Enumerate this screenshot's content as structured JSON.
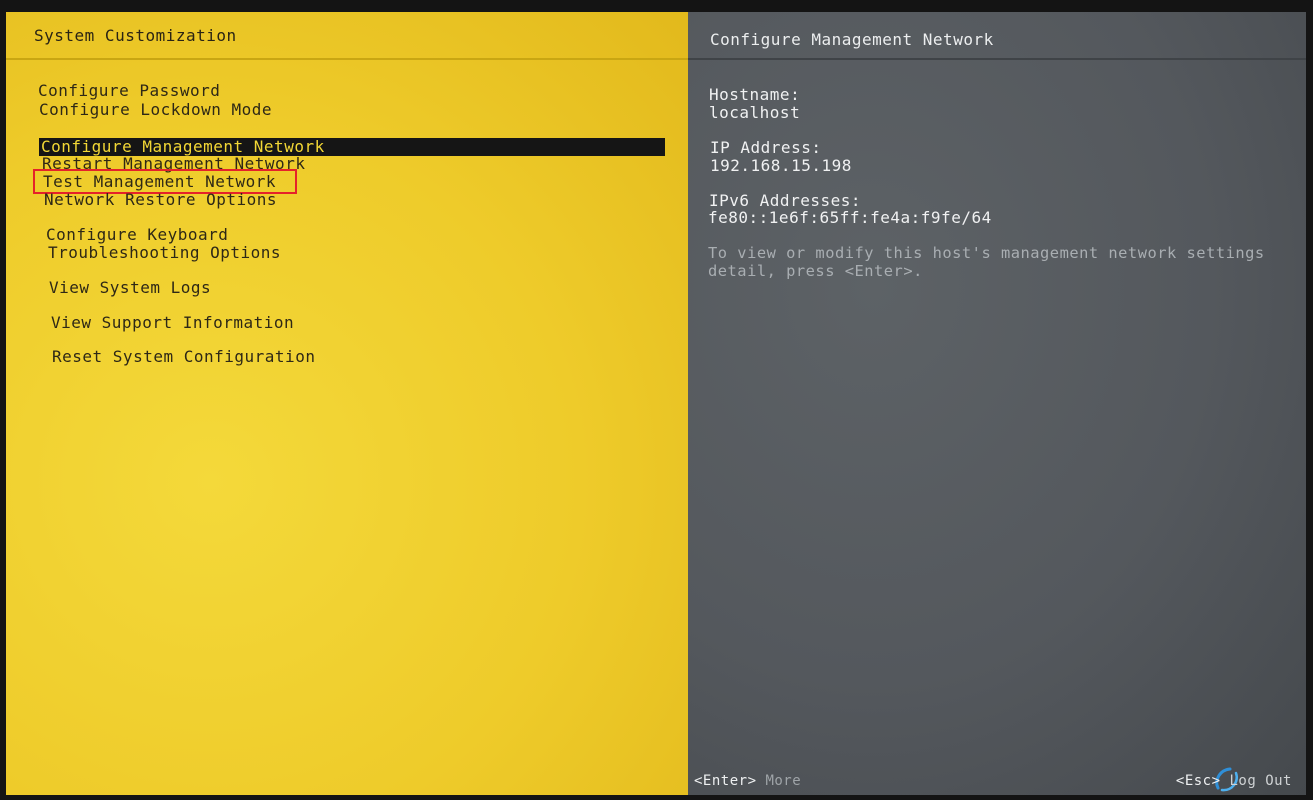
{
  "left_panel": {
    "title": "System Customization",
    "menu": [
      {
        "id": "configure-password",
        "label": "Configure Password"
      },
      {
        "id": "configure-lockdown-mode",
        "label": "Configure Lockdown Mode"
      },
      {
        "id": "configure-management-network",
        "label": "Configure Management Network",
        "selected": true
      },
      {
        "id": "restart-management-network",
        "label": "Restart Management Network"
      },
      {
        "id": "test-management-network",
        "label": "Test Management Network",
        "highlighted": true
      },
      {
        "id": "network-restore-options",
        "label": "Network Restore Options"
      },
      {
        "id": "configure-keyboard",
        "label": "Configure Keyboard"
      },
      {
        "id": "troubleshooting-options",
        "label": "Troubleshooting Options"
      },
      {
        "id": "view-system-logs",
        "label": "View System Logs"
      },
      {
        "id": "view-support-information",
        "label": "View Support Information"
      },
      {
        "id": "reset-system-configuration",
        "label": "Reset System Configuration"
      }
    ]
  },
  "right_panel": {
    "title": "Configure Management Network",
    "hostname_label": "Hostname:",
    "hostname_value": "localhost",
    "ip_label": "IP Address:",
    "ip_value": "192.168.15.198",
    "ipv6_label": "IPv6 Addresses:",
    "ipv6_value": "fe80::1e6f:65ff:fe4a:f9fe/64",
    "hint_line1": "To view or modify this host's management network settings",
    "hint_line2": "detail, press <Enter>."
  },
  "footer": {
    "left_key": "<Enter>",
    "left_desc": "More",
    "right_key": "<Esc>",
    "right_desc": "Log Out"
  },
  "colors": {
    "left_bg": "#eecb2a",
    "right_bg": "#54585d",
    "selection_bg": "#151515",
    "highlight_border": "#e5222a"
  },
  "icons": {
    "watermark": "watermark-icon"
  }
}
